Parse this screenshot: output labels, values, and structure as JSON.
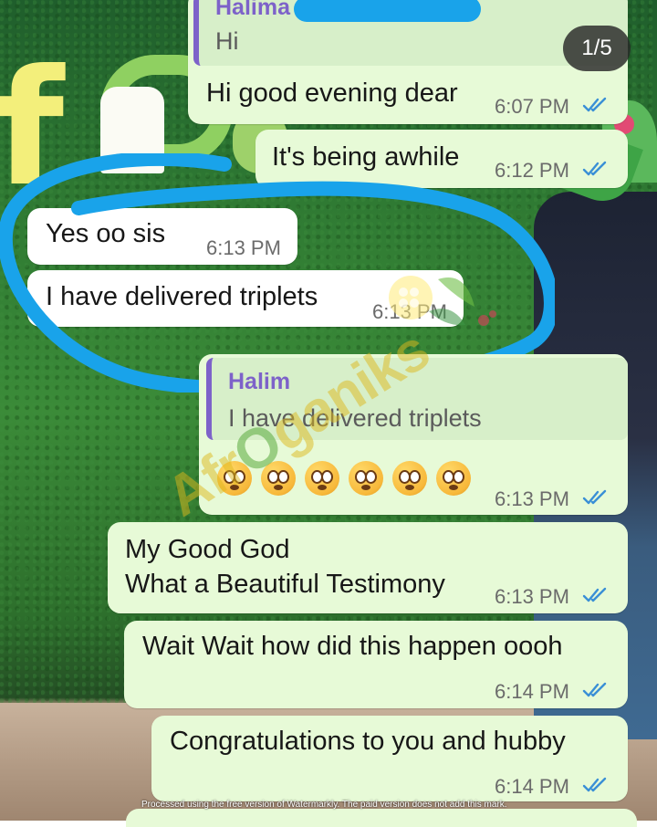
{
  "viewer": {
    "page_counter": "1/5"
  },
  "messages": [
    {
      "quote": {
        "name": "Halima",
        "text": "Hi"
      },
      "text": "Hi good evening dear",
      "time": "6:07 PM",
      "direction": "out"
    },
    {
      "text": "It's being awhile",
      "time": "6:12 PM",
      "direction": "out"
    },
    {
      "text": "Yes oo sis",
      "time": "6:13 PM",
      "direction": "in"
    },
    {
      "text": "I have delivered triplets",
      "time": "6:13 PM",
      "direction": "in"
    },
    {
      "quote": {
        "name": "Halim",
        "text": "I have delivered triplets"
      },
      "emoji": "😳😳😳😳😳😳",
      "time": "6:13 PM",
      "direction": "out"
    },
    {
      "line1": "My Good God",
      "line2": "What a Beautiful Testimony",
      "time": "6:13 PM",
      "direction": "out"
    },
    {
      "text": "Wait Wait how did this happen oooh",
      "time": "6:14 PM",
      "direction": "out"
    },
    {
      "text": "Congratulations to you and hubby",
      "time": "6:14 PM",
      "direction": "out"
    }
  ],
  "watermark": {
    "brand_prefix": "Afr",
    "brand_middle": "O",
    "brand_suffix": "ganiks",
    "footer_note": "Processed using the free version of Watermarkly. The paid version does not add this mark."
  },
  "colors": {
    "outgoing_bubble": "#e7fad7",
    "incoming_bubble": "#ffffff",
    "quote_accent": "#7d62c9",
    "read_ticks": "#3a8fd6",
    "highlight_circle": "#19a3ea"
  },
  "icons": {
    "read_receipt": "double-check-icon",
    "flushed_face": "flushed-face-emoji"
  }
}
